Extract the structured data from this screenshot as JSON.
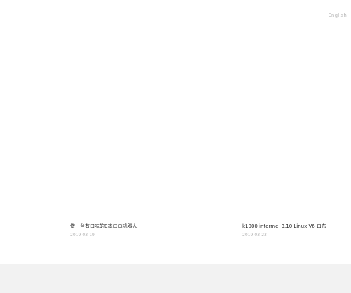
{
  "header": {
    "language_link": "English"
  },
  "posts": [
    {
      "title": "做一台有口味的0本ロロ机器人",
      "date": "2019-03-19"
    },
    {
      "title": "k1000 intermei 3.10 Linux V6 ロ布",
      "date": "2019-03-23"
    }
  ],
  "colors": {
    "background": "#ffffff",
    "footer": "#f2f2f2",
    "muted_text": "#b3b3b3",
    "title_text": "#1f1f1f"
  }
}
